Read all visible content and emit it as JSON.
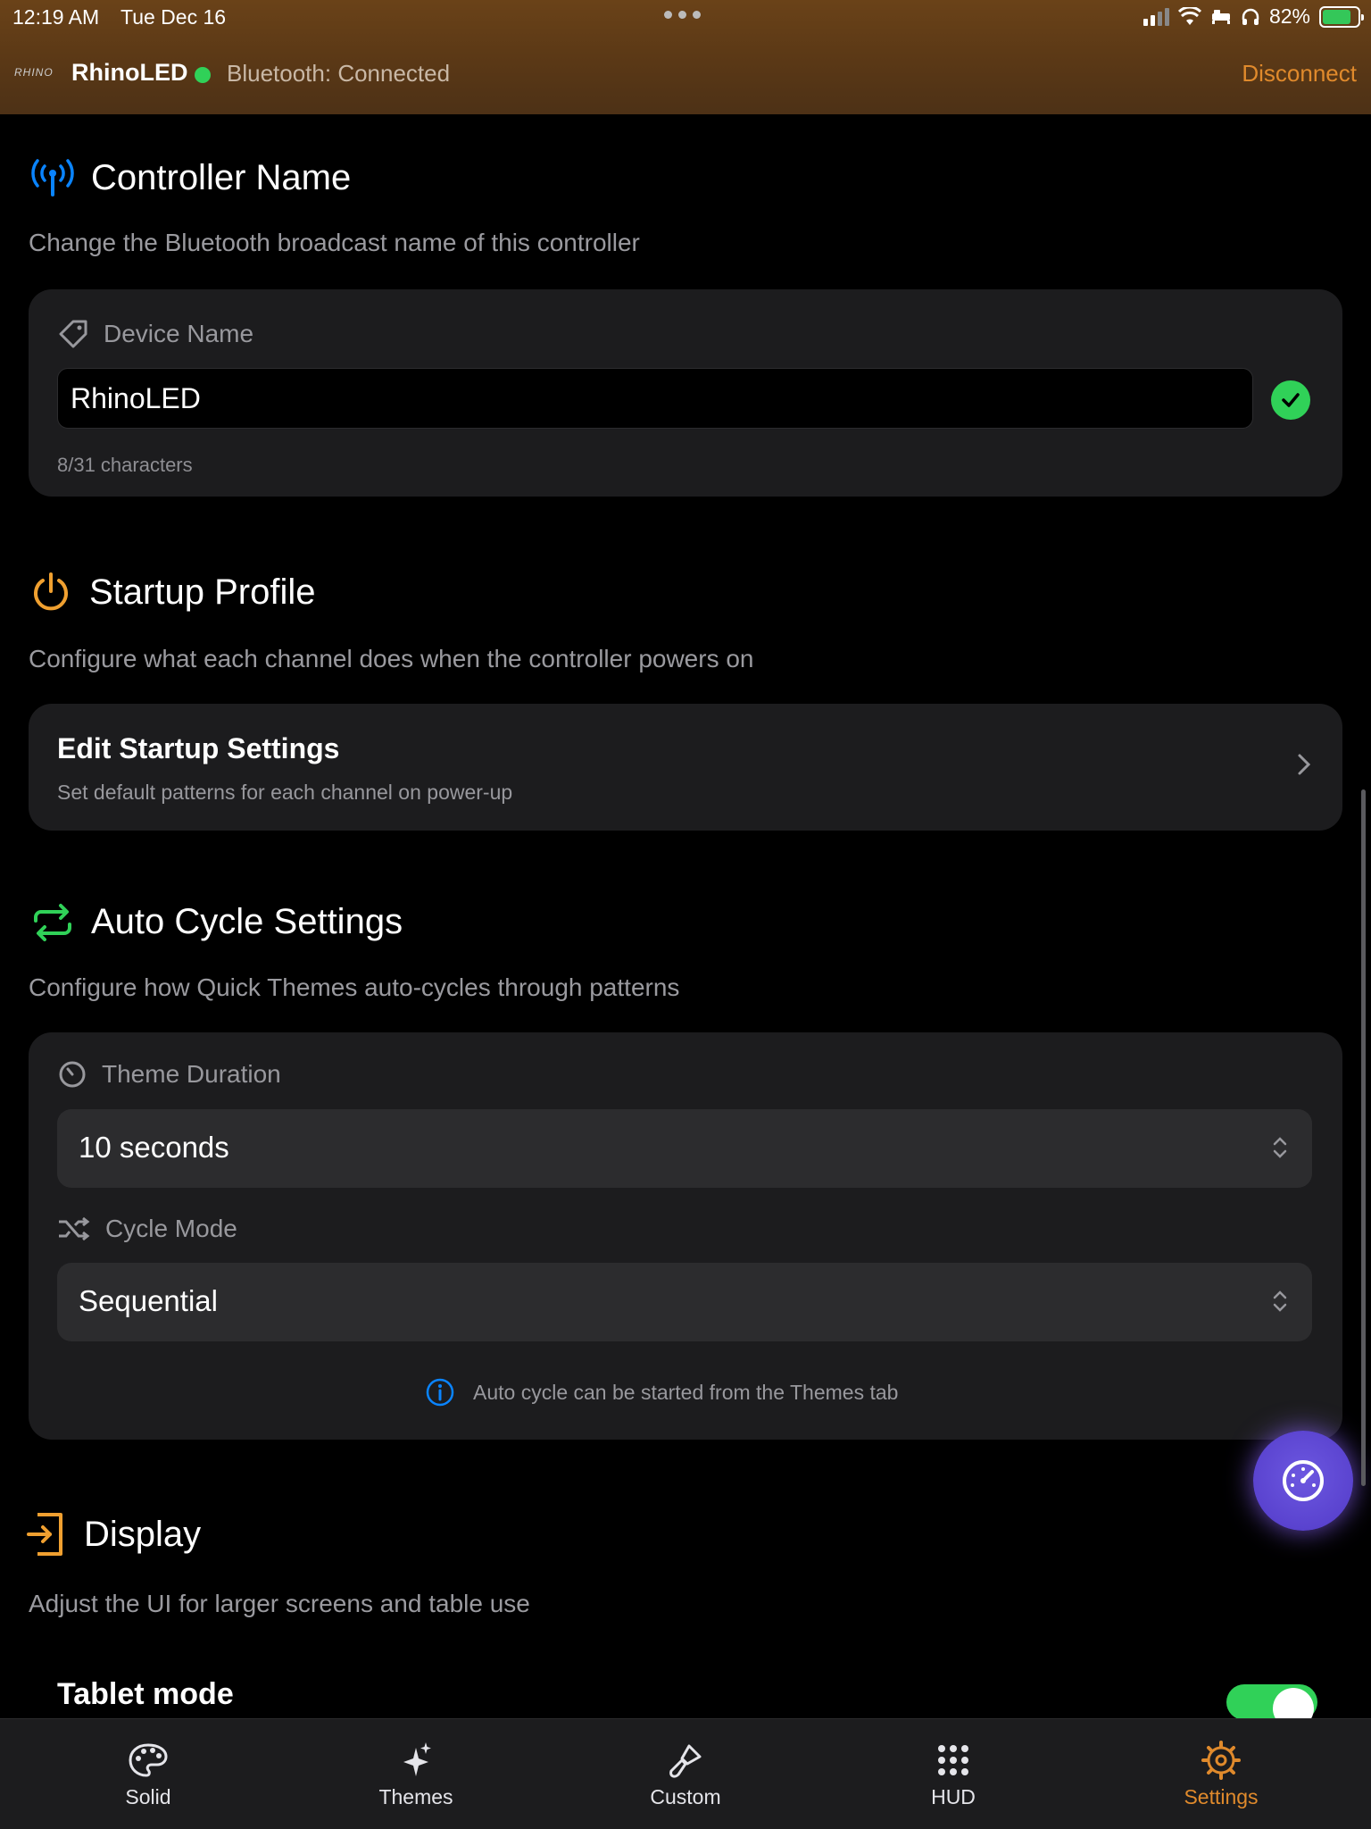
{
  "status": {
    "time": "12:19 AM",
    "date": "Tue Dec 16",
    "battery": "82%"
  },
  "header": {
    "logo": "RHINO",
    "app_name": "RhinoLED",
    "bluetooth_status": "Bluetooth: Connected",
    "disconnect": "Disconnect"
  },
  "controller_name": {
    "title": "Controller Name",
    "subtitle": "Change the Bluetooth broadcast name of this controller",
    "field_label": "Device Name",
    "value": "RhinoLED",
    "char_count": "8/31 characters"
  },
  "startup": {
    "title": "Startup Profile",
    "subtitle": "Configure what each channel does when the controller powers on",
    "row_title": "Edit Startup Settings",
    "row_subtitle": "Set default patterns for each channel on power-up"
  },
  "auto_cycle": {
    "title": "Auto Cycle Settings",
    "subtitle": "Configure how Quick Themes auto-cycles through patterns",
    "duration_label": "Theme Duration",
    "duration_value": "10 seconds",
    "mode_label": "Cycle Mode",
    "mode_value": "Sequential",
    "note": "Auto cycle can be started from the Themes tab"
  },
  "display": {
    "title": "Display",
    "subtitle": "Adjust the UI for larger screens and table use",
    "tablet_mode": "Tablet mode",
    "tablet_mode_on": true
  },
  "tabs": [
    {
      "label": "Solid",
      "icon": "palette-icon"
    },
    {
      "label": "Themes",
      "icon": "sparkles-icon"
    },
    {
      "label": "Custom",
      "icon": "paintbrush-icon"
    },
    {
      "label": "HUD",
      "icon": "grid-icon"
    },
    {
      "label": "Settings",
      "icon": "gear-icon",
      "active": true
    }
  ],
  "colors": {
    "accent": "#e08a2c",
    "success": "#30d158",
    "info": "#0a84ff",
    "fab": "#5a43cf"
  }
}
